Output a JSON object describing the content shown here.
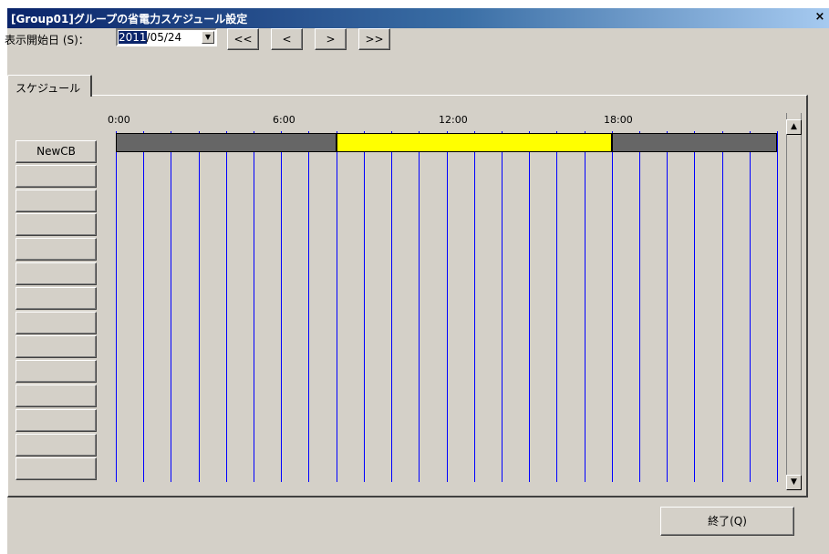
{
  "window": {
    "title": "[Group01]グループの省電力スケジュール設定",
    "close_label": "×"
  },
  "date": {
    "label": "表示開始日 (S)：",
    "value_highlight": "2011",
    "value_rest": "/05/24",
    "dropdown_icon": "▼"
  },
  "nav": {
    "first": "<<",
    "prev": "<",
    "next": ">",
    "last": ">>"
  },
  "tab": {
    "label": "スケジュール"
  },
  "timeline": {
    "ticks": [
      "0:00",
      "6:00",
      "12:00",
      "18:00"
    ],
    "rows": [
      "NewCB",
      "",
      "",
      "",
      "",
      "",
      "",
      "",
      "",
      "",
      "",
      "",
      "",
      ""
    ],
    "segments": [
      {
        "start": "0:00",
        "end": "8:00",
        "color": "#666666"
      },
      {
        "start": "8:00",
        "end": "18:00",
        "color": "#ffff00"
      },
      {
        "start": "18:00",
        "end": "24:00",
        "color": "#666666"
      }
    ],
    "grid_color": "#0000ff"
  },
  "scrollbar": {
    "up_icon": "▲",
    "down_icon": "▼"
  },
  "footer": {
    "exit_label": "終了(Q)"
  }
}
